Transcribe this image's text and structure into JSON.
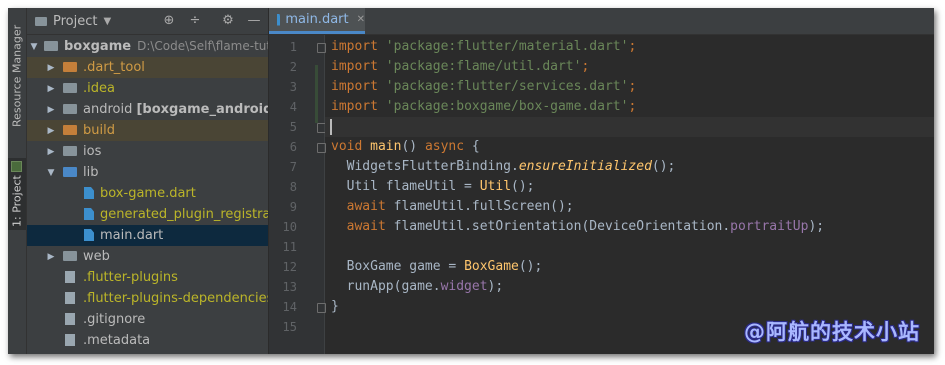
{
  "sidebar_tabs": {
    "resource_manager": "Resource Manager",
    "project": "1: Project"
  },
  "project_panel": {
    "title": "Project",
    "root": {
      "name": "boxgame",
      "path": "D:\\Code\\Self\\flame-tutorial"
    },
    "items": [
      {
        "label": ".dart_tool",
        "type": "folder",
        "excluded": true
      },
      {
        "label": ".idea",
        "type": "folder",
        "excluded": false
      },
      {
        "label": "android",
        "suffix": "[boxgame_android]",
        "type": "folder",
        "excluded": false
      },
      {
        "label": "build",
        "type": "folder",
        "excluded": true
      },
      {
        "label": "ios",
        "type": "folder",
        "excluded": false
      },
      {
        "label": "lib",
        "type": "folder",
        "expanded": true
      },
      {
        "label": "box-game.dart",
        "type": "dart"
      },
      {
        "label": "generated_plugin_registrant.dart",
        "type": "dart"
      },
      {
        "label": "main.dart",
        "type": "dart",
        "selected": true
      },
      {
        "label": "web",
        "type": "folder"
      },
      {
        "label": ".flutter-plugins",
        "type": "file"
      },
      {
        "label": ".flutter-plugins-dependencies",
        "type": "file"
      },
      {
        "label": ".gitignore",
        "type": "file"
      },
      {
        "label": ".metadata",
        "type": "file"
      }
    ]
  },
  "editor": {
    "tab": "main.dart",
    "line_numbers": [
      "1",
      "2",
      "3",
      "4",
      "5",
      "6",
      "7",
      "8",
      "9",
      "10",
      "11",
      "12",
      "13",
      "14",
      "15"
    ],
    "lines": {
      "l1_kw": "import",
      "l1_str": "'package:flutter/material.dart'",
      "l1_end": ";",
      "l2_kw": "import",
      "l2_str": "'package:flame/util.dart'",
      "l2_end": ";",
      "l3_kw": "import",
      "l3_str": "'package:flutter/services.dart'",
      "l3_end": ";",
      "l4_kw": "import",
      "l4_str": "'package:boxgame/box-game.dart'",
      "l4_end": ";",
      "l6_kw": "void",
      "l6_fn": "main",
      "l6_mid": "() ",
      "l6_async": "async",
      "l6_end": " {",
      "l7_a": "  WidgetsFlutterBinding.",
      "l7_fn": "ensureInitialized",
      "l7_end": "();",
      "l8_a": "  Util flameUtil = ",
      "l8_fn": "Util",
      "l8_end": "();",
      "l9_kw": "  await",
      "l9_a": " flameUtil.fullScreen();",
      "l10_kw": "  await",
      "l10_a": " flameUtil.setOrientation(DeviceOrientation.",
      "l10_prop": "portraitUp",
      "l10_end": ");",
      "l12_a": "  BoxGame game = ",
      "l12_fn": "BoxGame",
      "l12_end": "();",
      "l13_a": "  runApp(game.",
      "l13_prop": "widget",
      "l13_end": ");",
      "l14": "}"
    }
  },
  "watermark": "@阿航的技术小站"
}
